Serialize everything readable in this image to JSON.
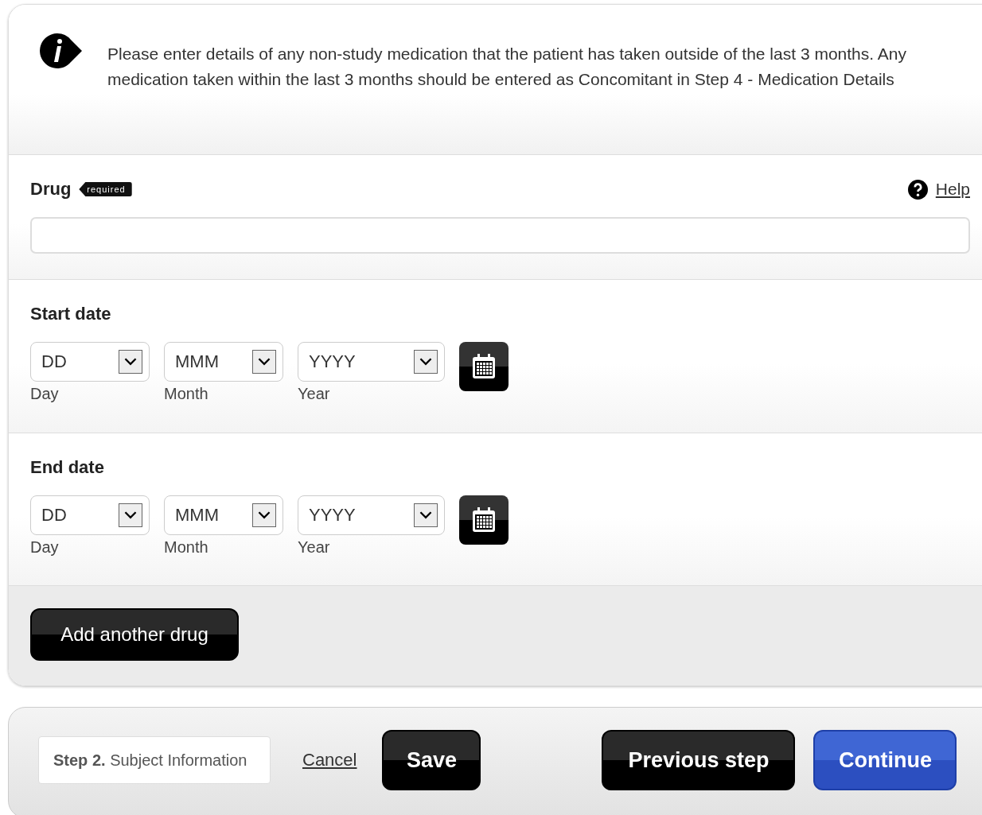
{
  "info": {
    "text": "Please enter details of any non-study medication that the patient has taken outside of the last 3 months. Any medication taken within the last 3 months should be entered as Concomitant in Step 4 - Medication Details"
  },
  "drug": {
    "label": "Drug",
    "badge": "required",
    "help": "Help"
  },
  "date_sections": [
    {
      "label": "Start date",
      "fields": [
        {
          "placeholder": "DD",
          "caption": "Day"
        },
        {
          "placeholder": "MMM",
          "caption": "Month"
        },
        {
          "placeholder": "YYYY",
          "caption": "Year"
        }
      ]
    },
    {
      "label": "End date",
      "fields": [
        {
          "placeholder": "DD",
          "caption": "Day"
        },
        {
          "placeholder": "MMM",
          "caption": "Month"
        },
        {
          "placeholder": "YYYY",
          "caption": "Year"
        }
      ]
    }
  ],
  "add_button": "Add another drug",
  "footer": {
    "step": "**Step 2.** Subject Information",
    "cancel": "Cancel",
    "save": "Save",
    "previous": "Previous step",
    "continue": "Continue"
  }
}
